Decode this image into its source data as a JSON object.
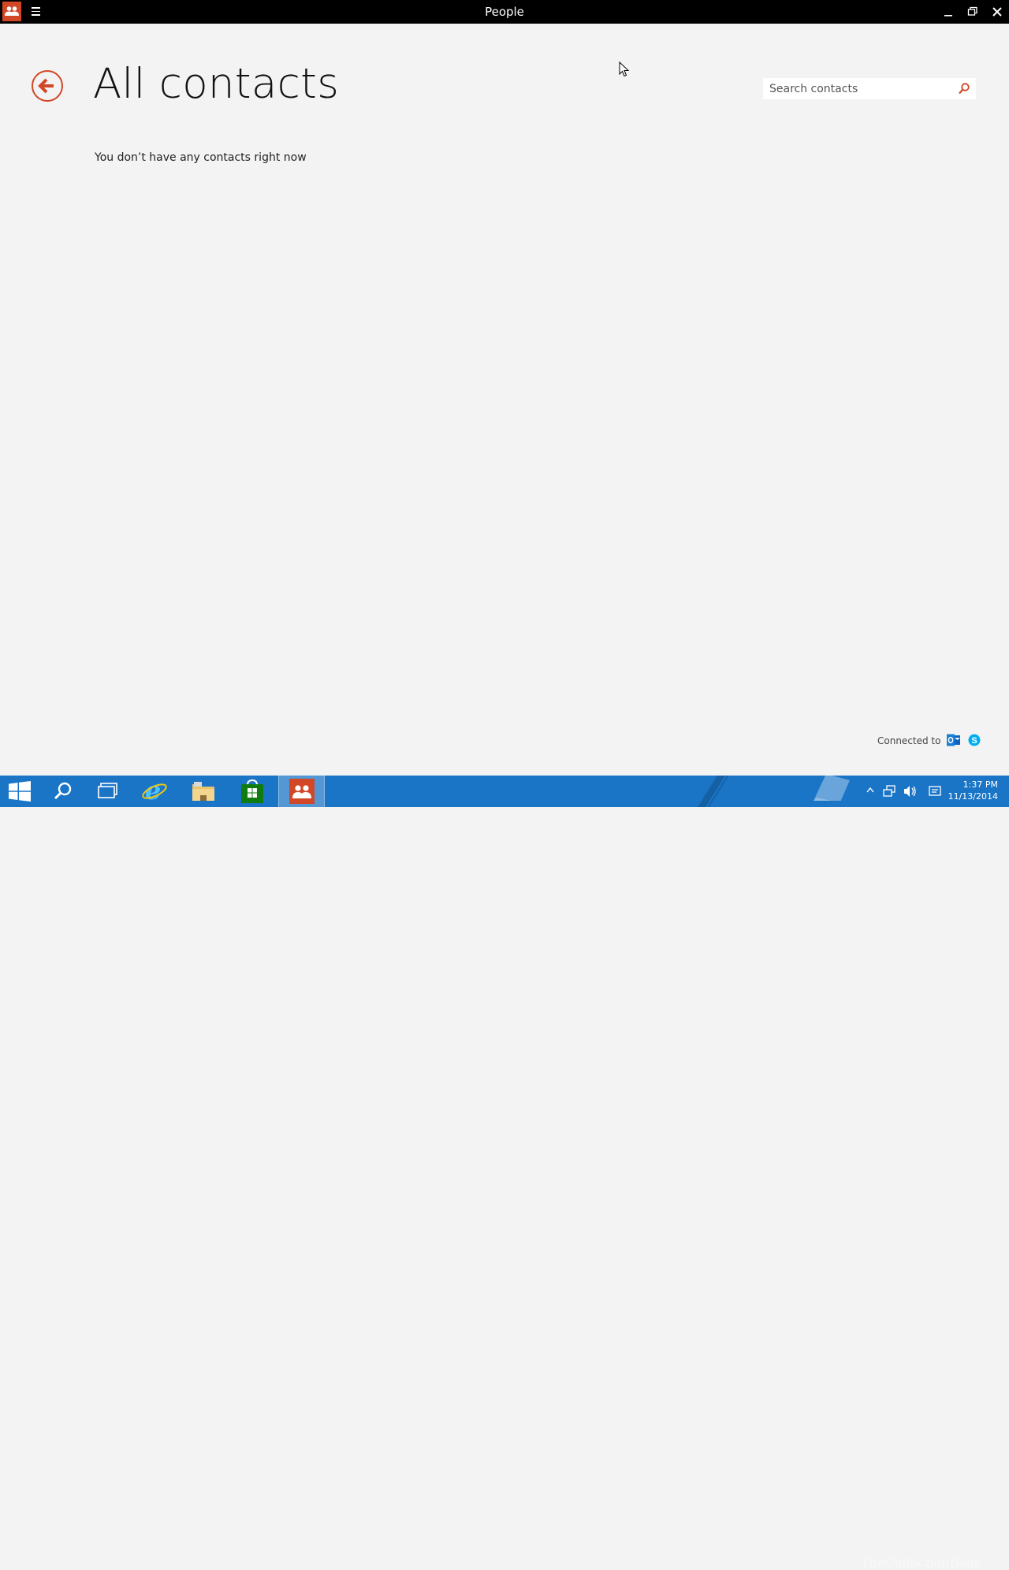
{
  "window": {
    "title": "People",
    "app_icon": "people-icon",
    "menu_icon": "hamburger-icon",
    "controls": [
      "minimize-icon",
      "restore-icon",
      "close-icon"
    ]
  },
  "page": {
    "title": "All contacts",
    "empty_message": "You don’t have any contacts right now",
    "back_icon": "back-arrow-icon"
  },
  "search": {
    "placeholder": "Search contacts",
    "value": "",
    "icon": "search-icon"
  },
  "footer": {
    "connected_label": "Connected to",
    "services": [
      "outlook-icon",
      "skype-icon"
    ]
  },
  "taskbar": {
    "items": [
      "start-icon",
      "search-icon",
      "task-view-icon",
      "internet-explorer-icon",
      "file-explorer-icon",
      "store-icon",
      "people-icon"
    ],
    "active": "people-icon",
    "clock": {
      "time": "1:37 PM",
      "date": "11/13/2014"
    },
    "watermark": "TheCollectionBook"
  },
  "colors": {
    "accent": "#d24726",
    "background": "#f3f3f3",
    "titlebar": "#000000",
    "taskbar": "#1a75c7"
  }
}
